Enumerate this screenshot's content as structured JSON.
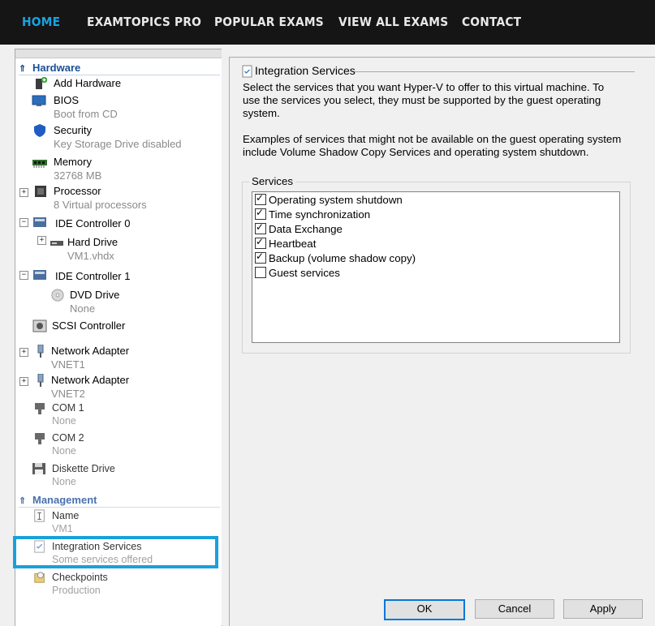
{
  "topnav": {
    "items": [
      {
        "label": "HOME",
        "active": true
      },
      {
        "label": "EXAMTOPICS PRO"
      },
      {
        "label": "POPULAR EXAMS"
      },
      {
        "label": "VIEW ALL EXAMS"
      },
      {
        "label": "CONTACT"
      }
    ]
  },
  "sidebar": {
    "hardware_header": "Hardware",
    "management_header": "Management",
    "items": {
      "add_hardware": {
        "label": "Add Hardware"
      },
      "bios": {
        "label": "BIOS",
        "sub": "Boot from CD"
      },
      "security": {
        "label": "Security",
        "sub": "Key Storage Drive disabled"
      },
      "memory": {
        "label": "Memory",
        "sub": "32768 MB"
      },
      "processor": {
        "label": "Processor",
        "sub": "8 Virtual processors"
      },
      "ide0": {
        "label": "IDE Controller 0"
      },
      "hard_drive": {
        "label": "Hard Drive",
        "sub": "VM1.vhdx"
      },
      "ide1": {
        "label": "IDE Controller 1"
      },
      "dvd": {
        "label": "DVD Drive",
        "sub": "None"
      },
      "scsi": {
        "label": "SCSI Controller"
      },
      "net1": {
        "label": "Network Adapter",
        "sub": "VNET1"
      },
      "net2": {
        "label": "Network Adapter",
        "sub": "VNET2"
      },
      "com1": {
        "label": "COM 1",
        "sub": "None"
      },
      "com2": {
        "label": "COM 2",
        "sub": "None"
      },
      "diskette": {
        "label": "Diskette Drive",
        "sub": "None"
      },
      "name": {
        "label": "Name",
        "sub": "VM1"
      },
      "integration": {
        "label": "Integration Services",
        "sub": "Some services offered"
      },
      "checkpoints": {
        "label": "Checkpoints",
        "sub": "Production"
      }
    }
  },
  "panel": {
    "title": "Integration Services",
    "description": "Select the services that you want Hyper-V to offer to this virtual machine. To use the services you select, they must be supported by the guest operating system.",
    "examples": "Examples of services that might not be available on the guest operating system include Volume Shadow Copy Services and operating system shutdown.",
    "services_label": "Services",
    "services": [
      {
        "label": "Operating system shutdown",
        "checked": true
      },
      {
        "label": "Time synchronization",
        "checked": true
      },
      {
        "label": "Data Exchange",
        "checked": true
      },
      {
        "label": "Heartbeat",
        "checked": true
      },
      {
        "label": "Backup (volume shadow copy)",
        "checked": true
      },
      {
        "label": "Guest services",
        "checked": false
      }
    ]
  },
  "buttons": {
    "ok": "OK",
    "cancel": "Cancel",
    "apply": "Apply"
  },
  "colors": {
    "accent": "#1aa0dc",
    "nav_bg": "#151515",
    "section_header": "#1a4e98"
  }
}
